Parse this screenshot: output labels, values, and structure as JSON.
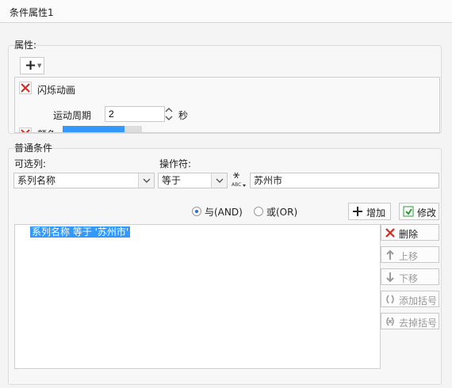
{
  "window": {
    "title": "条件属性1"
  },
  "properties": {
    "label": "属性:",
    "add_symbol": "+",
    "items": [
      {
        "name": "闪烁动画",
        "period_label": "运动周期",
        "period_value": "2",
        "unit": "秒"
      },
      {
        "name": "颜色"
      }
    ]
  },
  "conditions": {
    "label": "普通条件",
    "column_label": "可选列:",
    "column_value": "系列名称",
    "operator_label": "操作符:",
    "operator_value": "等于",
    "value_input": "苏州市",
    "radio_and": "与(AND)",
    "radio_or": "或(OR)",
    "add_button": "增加",
    "modify_button": "修改",
    "list": [
      "系列名称 等于 '苏州市'"
    ],
    "delete_button": "删除",
    "up_button": "上移",
    "down_button": "下移",
    "add_bracket_button": "添加括号",
    "remove_bracket_button": "去掉括号"
  },
  "colors": {
    "selection": "#3399ff",
    "accent_bar": "#3399ff",
    "delete_red": "#d9261c",
    "add_green": "#2e9a3a"
  }
}
